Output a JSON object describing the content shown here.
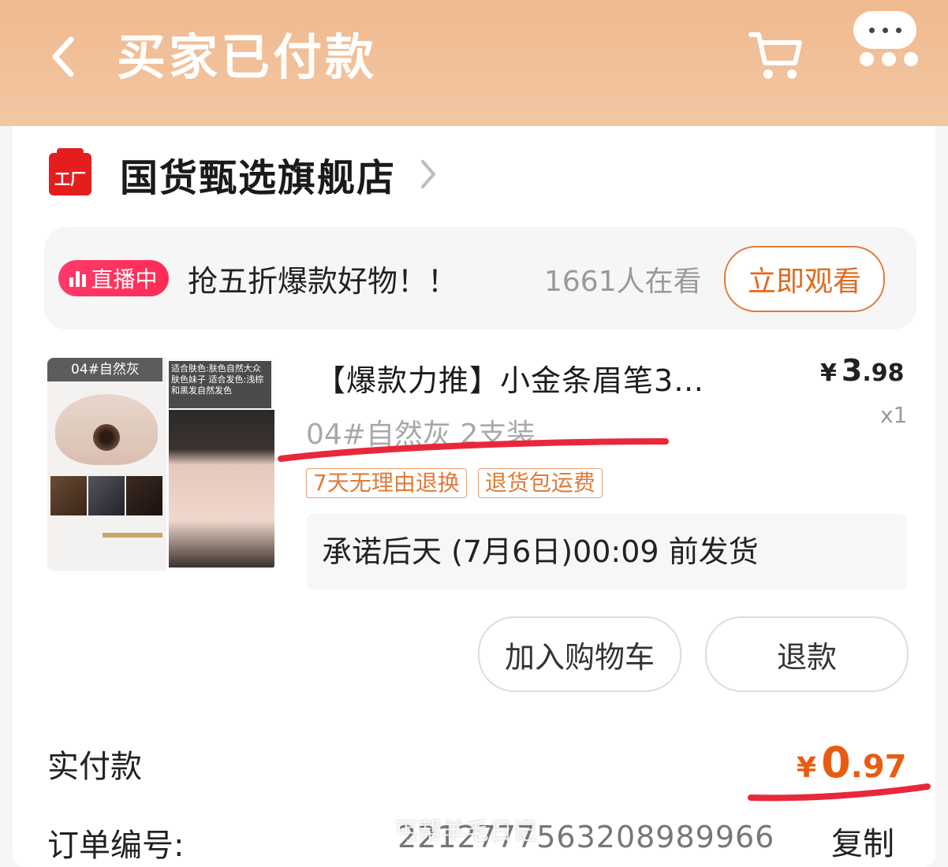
{
  "header": {
    "title": "买家已付款",
    "back_icon": "chevron-left-icon",
    "cart_icon": "cart-icon",
    "more_icon": "more-icon"
  },
  "store": {
    "icon_text": "工厂",
    "name": "国货甄选旗舰店"
  },
  "live": {
    "badge": "直播中",
    "text": "抢五折爆款好物！！",
    "viewers": "1661人在看",
    "watch_button": "立即观看"
  },
  "product": {
    "image_tag": "04#自然灰",
    "image_desc": "适合肤色:肤色自然大众肤色妹子 适合发色:浅棕和黑发自然发色",
    "title": "【爆款力推】小金条眉笔3…",
    "price_yen": "¥",
    "price_int": "3",
    "price_dec": ".98",
    "quantity": "x1",
    "spec": "04#自然灰 2支装",
    "badges": [
      "7天无理由退换",
      "退货包运费"
    ],
    "promise": "承诺后天 (7月6日)00:09 前发货"
  },
  "actions": {
    "add_to_cart": "加入购物车",
    "refund": "退款"
  },
  "payment": {
    "label": "实付款",
    "yen": "¥",
    "amount_int": "0",
    "amount_dec": ".97"
  },
  "order": {
    "label": "订单编号:",
    "number": "2212777563208989966",
    "copy": "复制"
  },
  "watermark": "丐帮羊毛日记",
  "colors": {
    "header_bg": "#f0b98f",
    "accent_orange": "#e85c12",
    "live_red": "#ff2c55",
    "store_red": "#e41d1d",
    "annotation_red": "#e8283a"
  }
}
